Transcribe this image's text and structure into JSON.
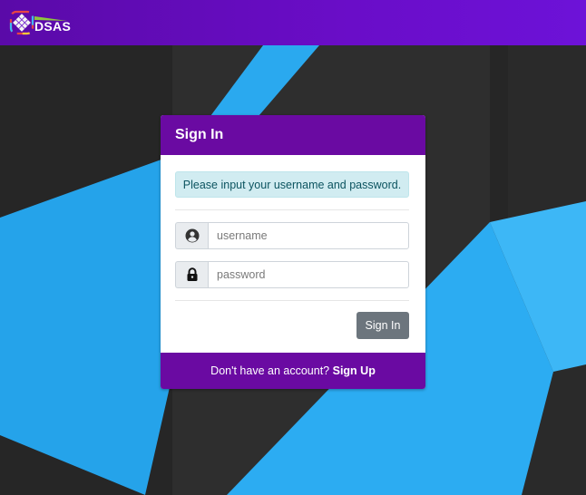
{
  "header": {
    "logo_text": "DSAS"
  },
  "card": {
    "title": "Sign In",
    "alert_text": "Please input your username and password.",
    "username": {
      "value": "",
      "placeholder": "username",
      "icon": "user-circle-icon"
    },
    "password": {
      "value": "",
      "placeholder": "password",
      "icon": "lock-icon"
    },
    "signin_label": "Sign In",
    "footer": {
      "prompt": "Don't have an account?",
      "signup_label": "Sign Up"
    }
  },
  "colors": {
    "header_bg": "#6a0dc8",
    "card_header_bg": "#6a0aa2",
    "alert_bg": "#d1ecf1",
    "alert_text": "#0c5460",
    "button_bg": "#6c757d",
    "bg_dark": "#262626",
    "bg_blue": "#29aaf0"
  }
}
